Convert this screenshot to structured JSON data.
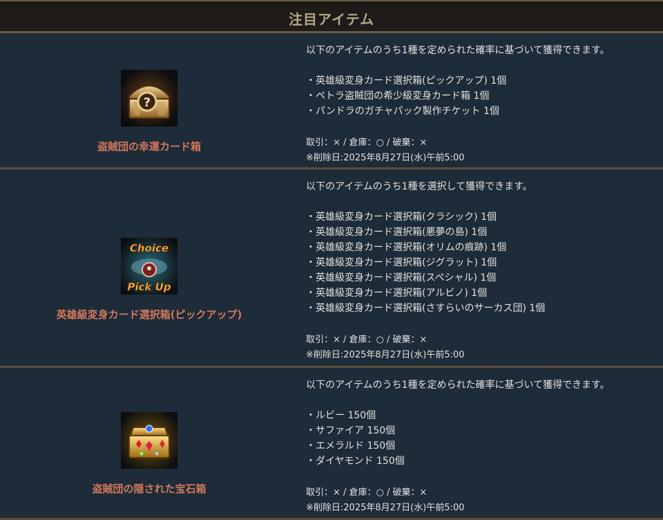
{
  "header": {
    "title": "注目アイテム"
  },
  "items": [
    {
      "name": "盗賊団の幸運カード箱",
      "icon": "treasure-chest-question-icon",
      "intro": "以下のアイテムのうち1種を定められた確率に基づいて獲得できます。",
      "contents": [
        "・英雄級変身カード選択箱(ピックアップ) 1個",
        "・ペトラ盗賊団の希少級変身カード箱 1個",
        "・パンドラのガチャパック製作チケット 1個"
      ],
      "trade": "取引：× / 倉庫：○ / 破棄：×",
      "delete_date": "※削除日:2025年8月27日(水)午前5:00"
    },
    {
      "name": "英雄級変身カード選択箱(ピックアップ)",
      "icon": "choice-pickup-box-icon",
      "icon_text_top": "Choice",
      "icon_text_bottom": "Pick Up",
      "intro": "以下のアイテムのうち1種を選択して獲得できます。",
      "contents": [
        "・英雄級変身カード選択箱(クラシック) 1個",
        "・英雄級変身カード選択箱(悪夢の島) 1個",
        "・英雄級変身カード選択箱(オリムの痕跡) 1個",
        "・英雄級変身カード選択箱(ジグラット) 1個",
        "・英雄級変身カード選択箱(スペシャル) 1個",
        "・英雄級変身カード選択箱(アルビノ) 1個",
        "・英雄級変身カード選択箱(さすらいのサーカス団) 1個"
      ],
      "trade": "取引：× / 倉庫：○ / 破棄：×",
      "delete_date": "※削除日:2025年8月27日(水)午前5:00"
    },
    {
      "name": "盗賊団の隠された宝石箱",
      "icon": "jewel-chest-icon",
      "intro": "以下のアイテムのうち1種を定められた確率に基づいて獲得できます。",
      "contents": [
        "・ルビー 150個",
        "・サファイア 150個",
        "・エメラルド 150個",
        "・ダイヤモンド 150個"
      ],
      "trade": "取引：× / 倉庫：○ / 破棄：×",
      "delete_date": "※削除日:2025年8月27日(水)午前5:00"
    }
  ]
}
